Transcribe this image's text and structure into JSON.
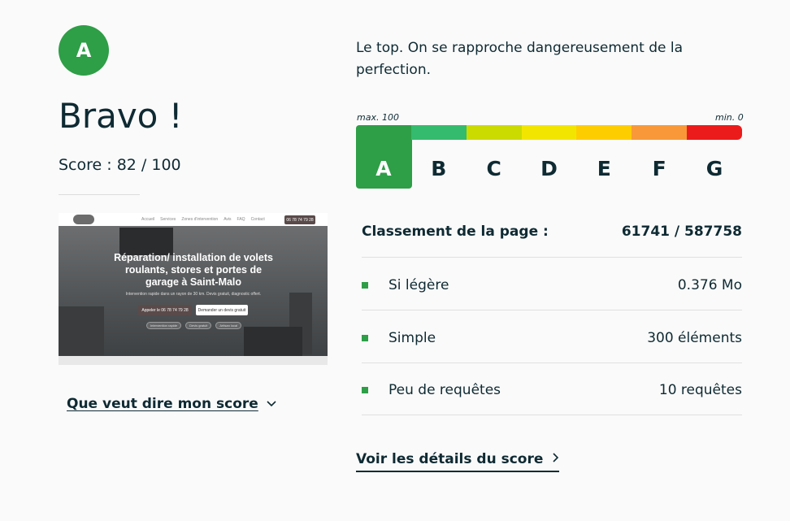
{
  "summary": {
    "grade": "A",
    "title": "Bravo !",
    "score_text": "Score : 82 / 100",
    "score": 82,
    "score_max": 100,
    "explain_link": "Que veut dire mon score",
    "verdict": "Le top. On se rapproche dangereusement de la perfection."
  },
  "preview": {
    "nav_links": [
      "Accueil",
      "Services",
      "Zones d'intervention",
      "Avis",
      "FAQ",
      "Contact"
    ],
    "nav_cta": "06 78 74 79 28",
    "headline": "Réparation/ installation de volets roulants, stores et portes de garage à Saint-Malo",
    "subline": "Intervention rapide dans un rayon de 30 km. Devis gratuit, diagnostic offert.",
    "btn_call": "Appeler le 06 78 74 79 28",
    "btn_quote": "Demander un devis gratuit",
    "pills": [
      "Intervention rapide",
      "Devis gratuit",
      "Artisan local"
    ]
  },
  "scale": {
    "max_label": "max. 100",
    "min_label": "min. 0",
    "active": "A",
    "grades": [
      {
        "letter": "A",
        "color": "#2e9e47"
      },
      {
        "letter": "B",
        "color": "#34bb6d"
      },
      {
        "letter": "C",
        "color": "#cbdb00"
      },
      {
        "letter": "D",
        "color": "#f2e600"
      },
      {
        "letter": "E",
        "color": "#fecd00"
      },
      {
        "letter": "F",
        "color": "#f99839"
      },
      {
        "letter": "G",
        "color": "#ec1b1b"
      }
    ]
  },
  "ranking": {
    "label": "Classement de la page :",
    "value": "61741 / 587758"
  },
  "metrics": [
    {
      "label": "Si légère",
      "value": "0.376 Mo"
    },
    {
      "label": "Simple",
      "value": "300 éléments"
    },
    {
      "label": "Peu de requêtes",
      "value": "10 requêtes"
    }
  ],
  "details_link": "Voir les détails du score",
  "colors": {
    "accent": "#2e9e47",
    "text": "#0e2a33"
  },
  "icons": {
    "explain": "chevron-down-icon",
    "details": "chevron-right-icon"
  }
}
